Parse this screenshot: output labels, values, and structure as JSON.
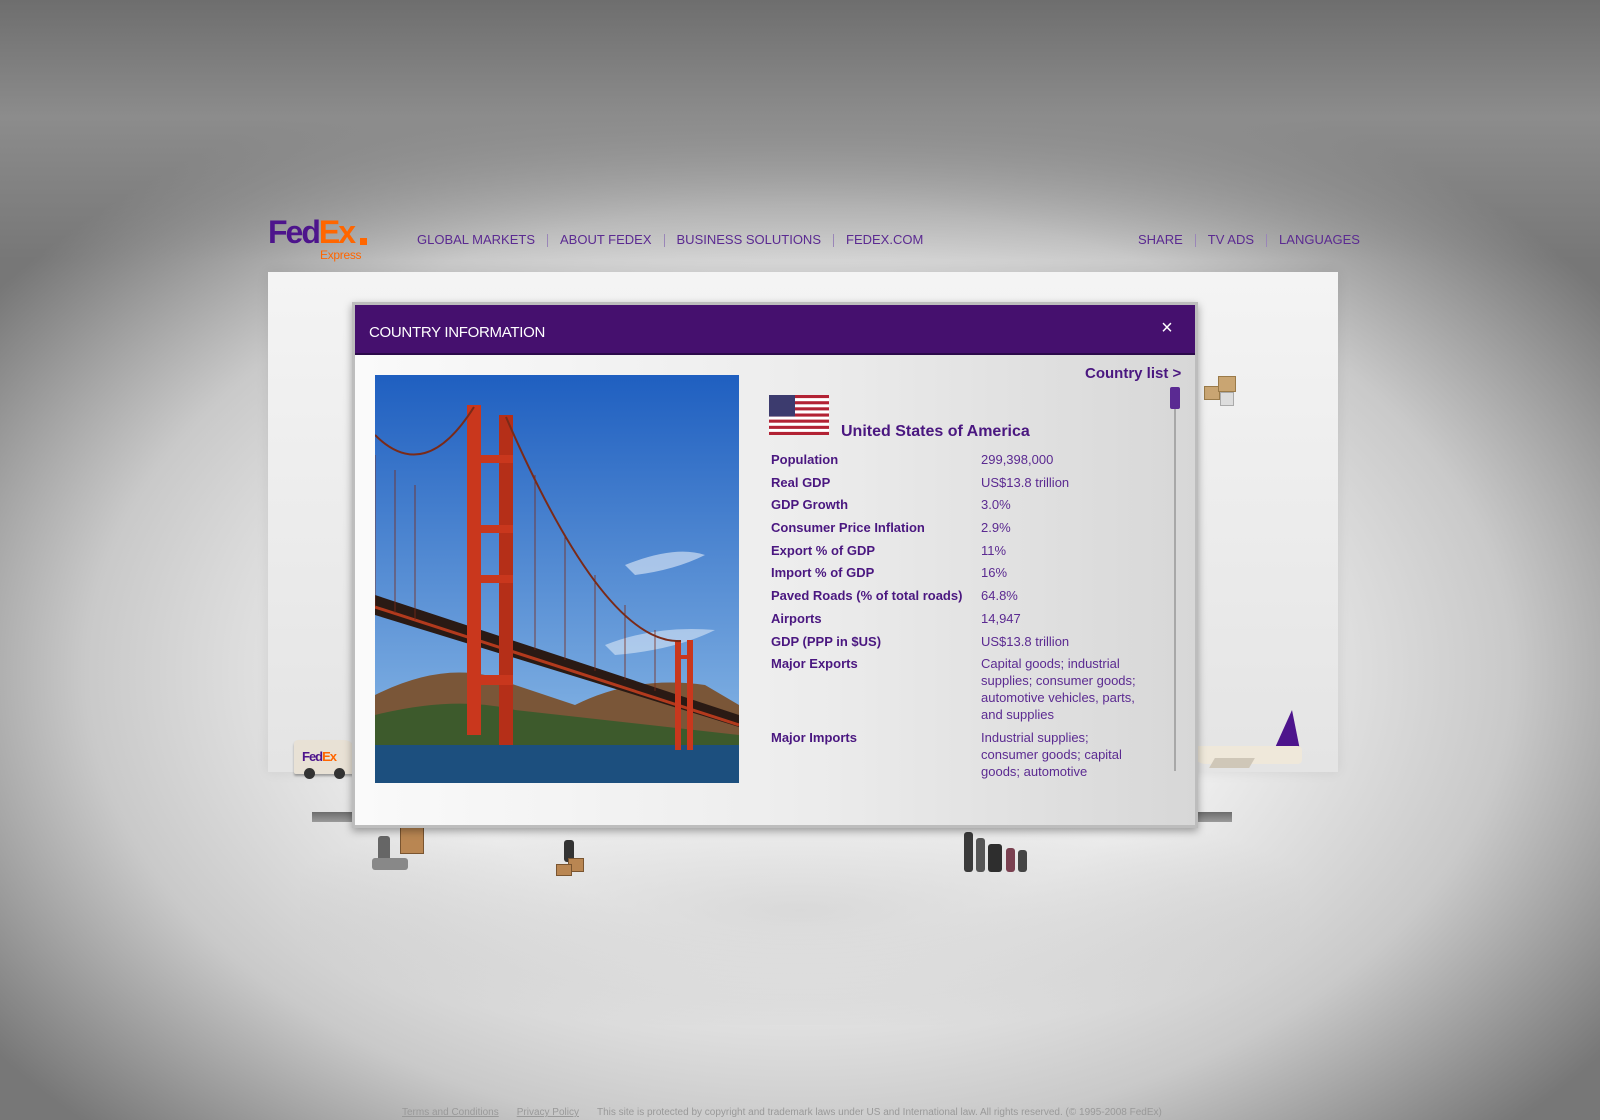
{
  "logo": {
    "main_purple": "Fed",
    "main_orange": "Ex",
    "sub": "Express"
  },
  "nav_left": [
    "GLOBAL MARKETS",
    "ABOUT FEDEX",
    "BUSINESS SOLUTIONS",
    "FEDEX.COM"
  ],
  "nav_right": [
    "SHARE",
    "TV ADS",
    "LANGUAGES"
  ],
  "modal": {
    "title": "COUNTRY INFORMATION",
    "close_icon": "×",
    "country_list_link": "Country list >",
    "country_name": "United States of America",
    "stats": [
      {
        "label": "Population",
        "value": "299,398,000"
      },
      {
        "label": "Real GDP",
        "value": "US$13.8 trillion"
      },
      {
        "label": "GDP Growth",
        "value": "3.0%"
      },
      {
        "label": "Consumer Price Inflation",
        "value": "2.9%"
      },
      {
        "label": "Export % of GDP",
        "value": "11%"
      },
      {
        "label": "Import % of GDP",
        "value": "16%"
      },
      {
        "label": "Paved Roads (% of total roads)",
        "value": "64.8%"
      },
      {
        "label": "Airports",
        "value": "14,947"
      },
      {
        "label": "GDP (PPP in $US)",
        "value": "US$13.8 trillion"
      },
      {
        "label": "Major Exports",
        "value": "Capital goods; industrial supplies; consumer goods; automotive vehicles, parts, and supplies"
      },
      {
        "label": "Major Imports",
        "value": "Industrial supplies; consumer goods; capital goods; automotive"
      }
    ]
  },
  "truck_logo": {
    "purple": "Fed",
    "orange": "Ex"
  },
  "footer": {
    "terms": "Terms and Conditions",
    "privacy": "Privacy Policy",
    "notice": "This site is protected by copyright and trademark laws under US and International law. All rights reserved. (© 1995-2008 FedEx)"
  },
  "colors": {
    "brand_purple": "#4d148c",
    "brand_orange": "#ff6600",
    "modal_bar": "#45106e"
  },
  "icons": {
    "close": "close-icon",
    "flag": "us-flag-icon"
  }
}
